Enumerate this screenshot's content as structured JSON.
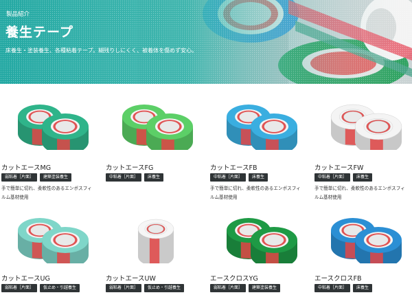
{
  "hero": {
    "crumb": "製品紹介",
    "title": "養生テープ",
    "desc": "床養生・塗装養生、各種粘着テープ。糊残りしにくく、被着体を傷めず安心。"
  },
  "products": [
    {
      "name": "カットエースMG",
      "tags": [
        "弱粘着［片面］",
        "建築塗装養生"
      ],
      "desc_line1": "手で簡単に切れ、柔軟性のあるエンボスフィ",
      "desc_line2": "ルム基材使用",
      "color": "#2fb48a"
    },
    {
      "name": "カットエースFG",
      "tags": [
        "中粘着［片面］",
        "床養生"
      ],
      "desc_line1": "",
      "desc_line2": "",
      "color": "#5ccf67"
    },
    {
      "name": "カットエースFB",
      "tags": [
        "中粘着［片面］",
        "床養生"
      ],
      "desc_line1": "手で簡単に切れ、柔軟性のあるエンボスフィ",
      "desc_line2": "ルム基材使用",
      "color": "#3aaee0"
    },
    {
      "name": "カットエースFW",
      "tags": [
        "中粘着［片面］",
        "床養生"
      ],
      "desc_line1": "手で簡単に切れ、柔軟性のあるエンボスフィ",
      "desc_line2": "ルム基材使用",
      "color": "#f4f4f4"
    },
    {
      "name": "カットエースUG",
      "tags": [
        "弱粘着［片面］",
        "仮止め・引越養生"
      ],
      "desc_line1": "",
      "desc_line2": "",
      "color": "#7fd6c9"
    },
    {
      "name": "カットエースUW",
      "tags": [
        "弱粘着［片面］",
        "仮止め・引越養生"
      ],
      "desc_line1": "",
      "desc_line2": "",
      "color": "#f6f6f6"
    },
    {
      "name": "エースクロスYG",
      "tags": [
        "弱粘着［片面］",
        "建築塗装養生"
      ],
      "desc_line1": "",
      "desc_line2": "",
      "color": "#1e9a45"
    },
    {
      "name": "エースクロスFB",
      "tags": [
        "中粘着［片面］",
        "床養生"
      ],
      "desc_line1": "",
      "desc_line2": "",
      "color": "#2b8fd4"
    }
  ]
}
